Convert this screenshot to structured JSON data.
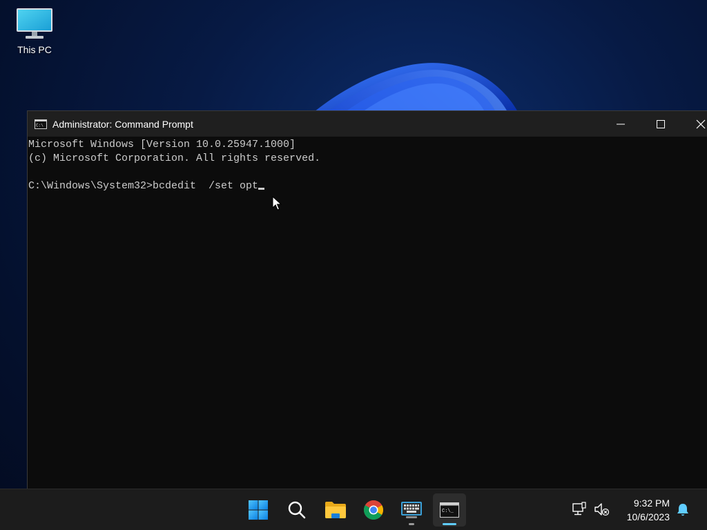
{
  "desktop": {
    "icons": [
      {
        "label": "This PC",
        "icon": "monitor-icon"
      }
    ]
  },
  "window": {
    "title": "Administrator: Command Prompt",
    "icon": "cmd-icon",
    "controls": {
      "minimize": "minimize-icon",
      "maximize": "maximize-icon",
      "close": "close-icon"
    }
  },
  "console": {
    "lines": [
      "Microsoft Windows [Version 10.0.25947.1000]",
      "(c) Microsoft Corporation. All rights reserved.",
      "",
      "C:\\Windows\\System32>bcdedit  /set opt"
    ]
  },
  "taskbar": {
    "items": [
      {
        "name": "start",
        "icon": "windows-logo-icon"
      },
      {
        "name": "search",
        "icon": "search-icon"
      },
      {
        "name": "file-explorer",
        "icon": "folder-icon"
      },
      {
        "name": "chrome",
        "icon": "chrome-icon"
      },
      {
        "name": "on-screen-keyboard",
        "icon": "keyboard-icon"
      },
      {
        "name": "command-prompt",
        "icon": "cmd-icon"
      }
    ],
    "tray": {
      "time": "9:32 PM",
      "date": "10/6/2023",
      "icons": [
        "network-icon",
        "volume-muted-icon",
        "notification-bell-icon"
      ]
    }
  },
  "colors": {
    "accent": "#60cdff",
    "console_bg": "#0c0c0c",
    "console_fg": "#cccccc",
    "titlebar_bg": "#1f1f1f",
    "taskbar_bg": "#1c1c1c"
  }
}
